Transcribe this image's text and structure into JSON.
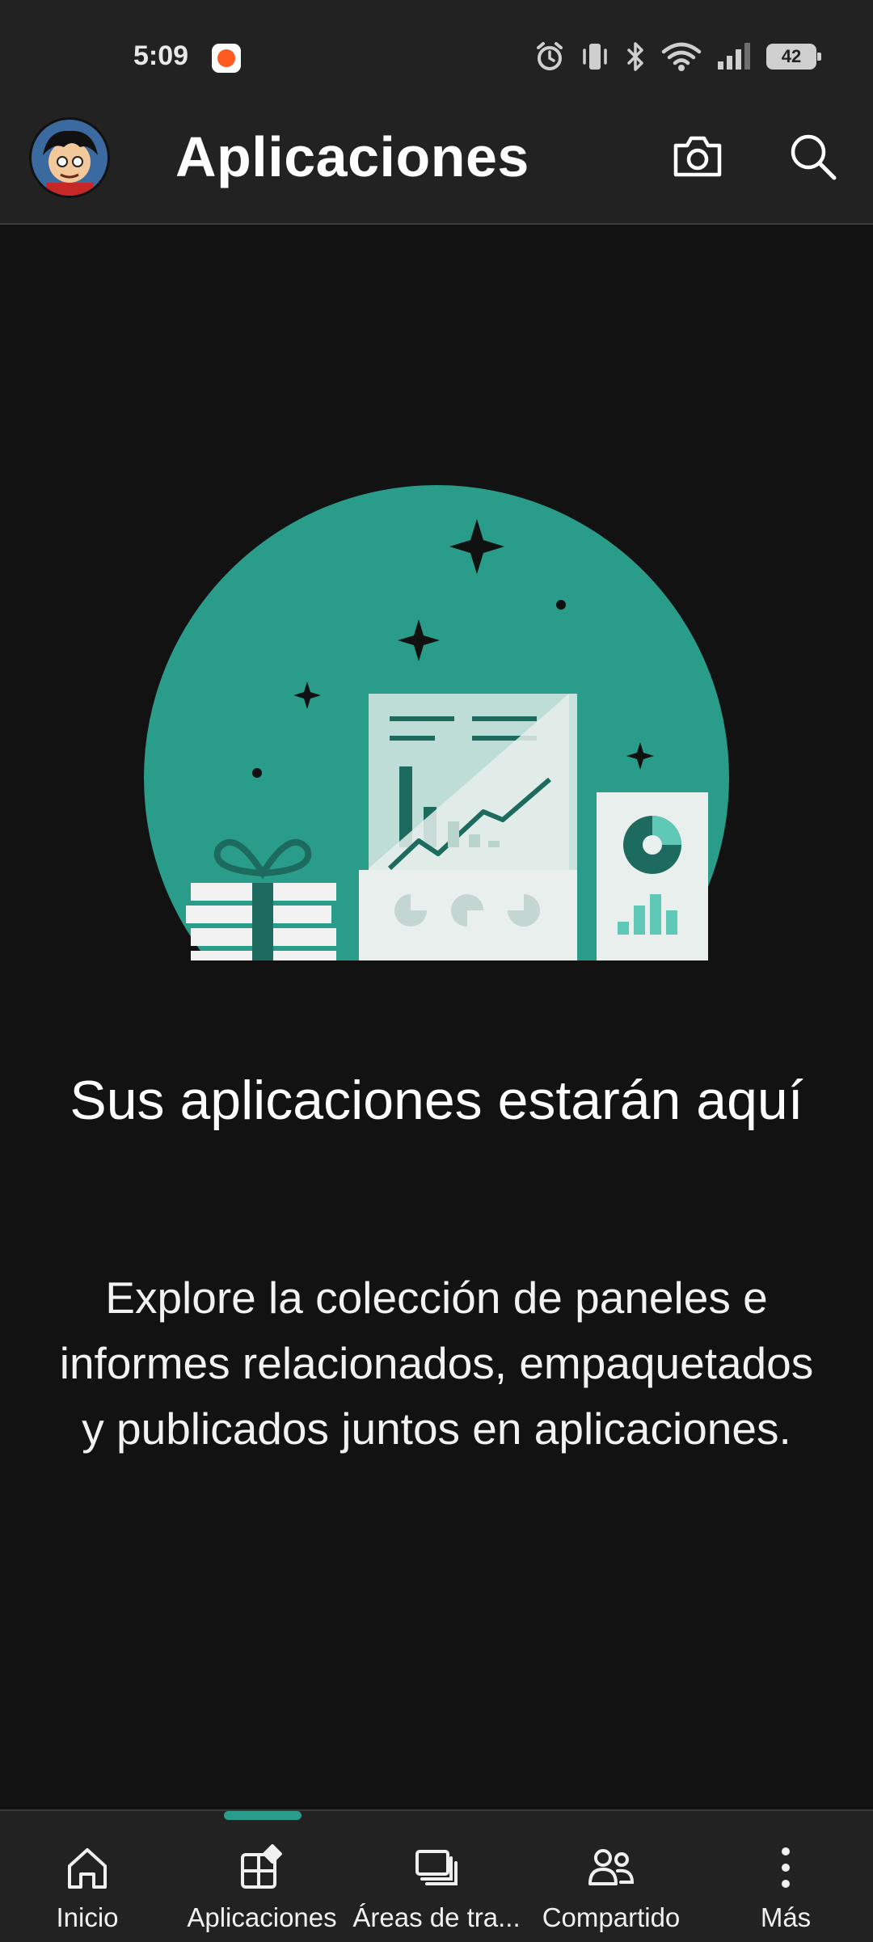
{
  "status_bar": {
    "time": "5:09",
    "battery_level": "42",
    "icons": [
      "notification-app-icon",
      "alarm-icon",
      "vibrate-icon",
      "bluetooth-icon",
      "wifi-icon",
      "signal-icon",
      "battery-icon"
    ]
  },
  "app_bar": {
    "title": "Aplicaciones",
    "actions": [
      "camera-icon",
      "search-icon"
    ]
  },
  "empty_state": {
    "title": "Sus aplicaciones estarán aquí",
    "description": "Explore la colección de paneles e informes relacionados, empaquetados y publicados juntos en aplicaciones.",
    "illustration": "apps-empty-illustration"
  },
  "bottom_nav": {
    "selected": "Aplicaciones",
    "items": [
      {
        "label": "Inicio",
        "icon": "home-icon"
      },
      {
        "label": "Aplicaciones",
        "icon": "apps-icon"
      },
      {
        "label": "Áreas de tra...",
        "icon": "workspaces-icon"
      },
      {
        "label": "Compartido",
        "icon": "shared-icon"
      },
      {
        "label": "Más",
        "icon": "more-icon"
      }
    ]
  },
  "colors": {
    "background": "#121212",
    "bars": "#222222",
    "accent": "#2a9d8a"
  }
}
